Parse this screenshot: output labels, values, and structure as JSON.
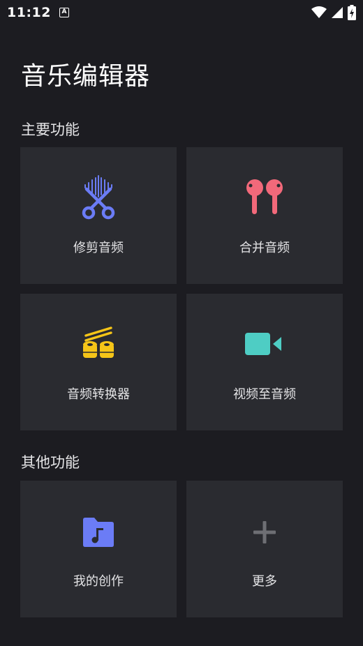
{
  "status_bar": {
    "time": "11:12",
    "notification_glyph": "A"
  },
  "header": {
    "title": "音乐编辑器"
  },
  "sections": {
    "main": {
      "title": "主要功能",
      "cards": [
        {
          "label": "修剪音频",
          "icon": "scissors-waveform-icon",
          "color": "#6b7cf6"
        },
        {
          "label": "合并音频",
          "icon": "earbuds-icon",
          "color": "#f2697a"
        },
        {
          "label": "音频转换器",
          "icon": "converter-rolls-icon",
          "color": "#f5c518"
        },
        {
          "label": "视频至音频",
          "icon": "video-camera-icon",
          "color": "#4ecdc4"
        }
      ]
    },
    "other": {
      "title": "其他功能",
      "cards": [
        {
          "label": "我的创作",
          "icon": "music-folder-icon",
          "color": "#6b7cf6"
        },
        {
          "label": "更多",
          "icon": "plus-icon",
          "color": "#6e6f74"
        }
      ]
    }
  }
}
